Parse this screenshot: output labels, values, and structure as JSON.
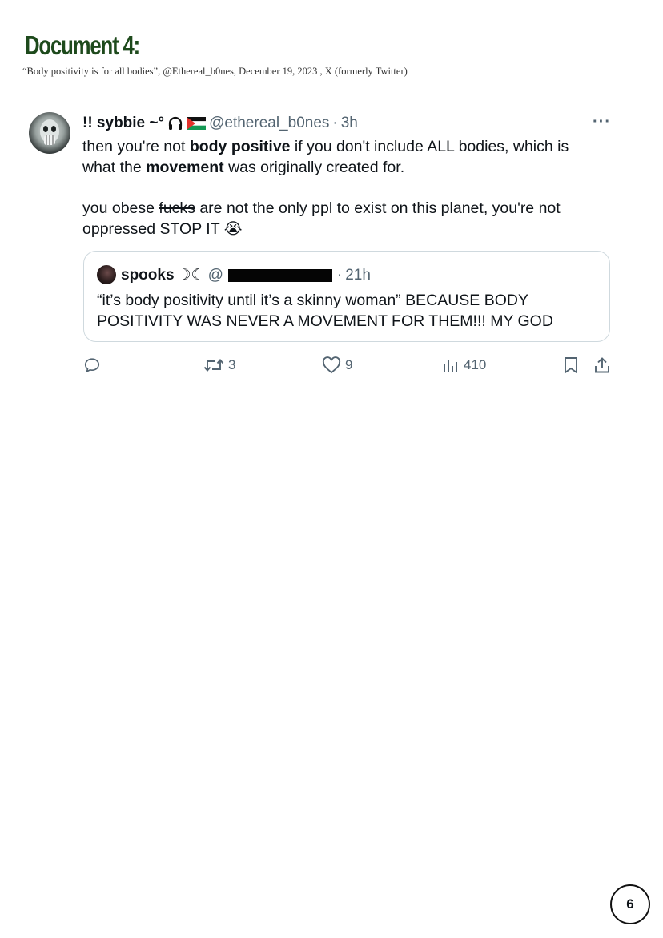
{
  "document": {
    "title": "Document 4:",
    "caption": "“Body positivity is for all bodies”, @Ethereal_b0nes, December 19, 2023 , X (formerly Twitter)"
  },
  "tweet": {
    "display_name": "!! sybbie ~°",
    "name_icons": [
      "headphones-icon",
      "palestine-flag-icon"
    ],
    "handle": "@ethereal_b0nes",
    "separator": "·",
    "time": "3h",
    "more": "···",
    "body": {
      "p1_a": "then you're not ",
      "p1_b": "body positive",
      "p1_c": " if you don't include ALL bodies, which is what the ",
      "p1_d": "movement",
      "p1_e": " was originally created for.",
      "p2_a": "you obese ",
      "p2_strike": "fucks",
      "p2_b": " are not the only ppl to exist on this planet, you're not oppressed STOP IT ",
      "p2_emoji": "😭"
    },
    "quote": {
      "display_name": "spooks",
      "name_suffix": "☽☾",
      "handle_prefix": "@",
      "separator": "·",
      "time": "21h",
      "body": "“it’s body positivity until it’s a skinny woman” BECAUSE BODY POSITIVITY WAS NEVER A MOVEMENT FOR THEM!!! MY GOD"
    },
    "actions": {
      "reply_count": "",
      "repost_count": "3",
      "like_count": "9",
      "views_count": "410"
    },
    "colors": {
      "text": "#0f1419",
      "secondary": "#536471",
      "border": "#cfd9de"
    }
  },
  "page_number": "6"
}
